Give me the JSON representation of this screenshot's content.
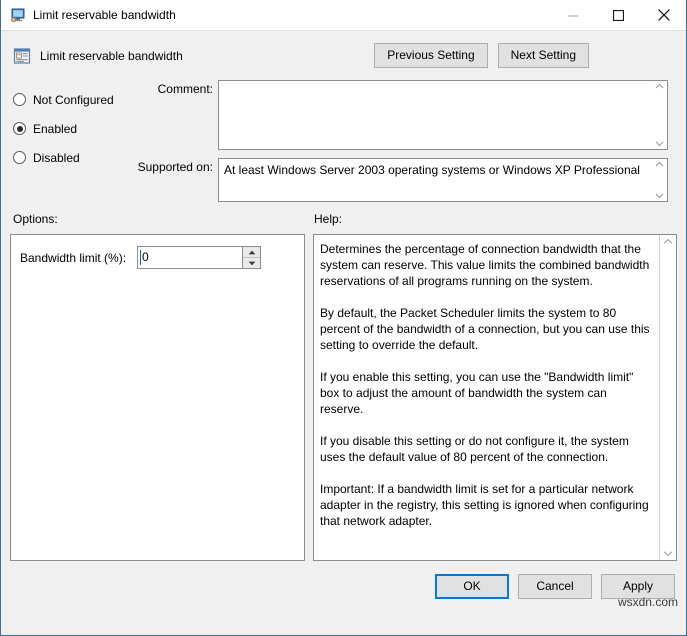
{
  "window": {
    "title": "Limit reservable bandwidth",
    "title_icon": "monitor-icon",
    "minimize_label": "Minimize",
    "maximize_label": "Maximize",
    "close_label": "Close",
    "accent_color": "#3a6ea5"
  },
  "header": {
    "icon": "policy-setting-icon",
    "title": "Limit reservable bandwidth",
    "previous_label": "Previous Setting",
    "next_label": "Next Setting"
  },
  "state": {
    "options": [
      {
        "label": "Not Configured",
        "selected": false
      },
      {
        "label": "Enabled",
        "selected": true
      },
      {
        "label": "Disabled",
        "selected": false
      }
    ]
  },
  "comment": {
    "label": "Comment:",
    "value": "",
    "placeholder": ""
  },
  "supported_on": {
    "label": "Supported on:",
    "value": "At least Windows Server 2003 operating systems or Windows XP Professional"
  },
  "sections": {
    "options_label": "Options:",
    "help_label": "Help:"
  },
  "options_pane": {
    "bandwidth_label": "Bandwidth limit (%):",
    "bandwidth_value": "0",
    "spin_up_label": "Increase",
    "spin_down_label": "Decrease"
  },
  "help_pane": {
    "paragraphs": [
      "Determines the percentage of connection bandwidth that the system can reserve. This value limits the combined bandwidth reservations of all programs running on the system.",
      "By default, the Packet Scheduler limits the system to 80 percent of the bandwidth of a connection, but you can use this setting to override the default.",
      "If you enable this setting, you can use the \"Bandwidth limit\" box to adjust the amount of bandwidth the system can reserve.",
      "If you disable this setting or do not configure it, the system uses the default value of 80 percent of the connection.",
      "Important: If a bandwidth limit is set for a particular network adapter in the registry, this setting is ignored when configuring that network adapter."
    ]
  },
  "footer": {
    "ok_label": "OK",
    "cancel_label": "Cancel",
    "apply_label": "Apply",
    "default_button_color": "#0078d7"
  },
  "watermark": {
    "text": "wsxdn.com"
  }
}
